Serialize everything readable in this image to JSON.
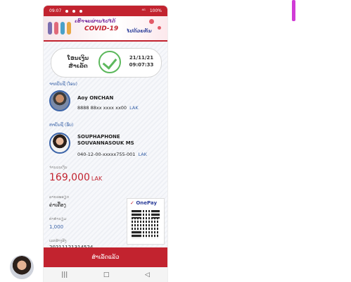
{
  "status_bar": {
    "time": "09:07",
    "net": "⁴ᴳ",
    "battery": "100%"
  },
  "banner": {
    "line1": "ເຮົາຈະຜ່ານໄປໄດ້",
    "line2": "COVID-19",
    "line3": "ໄປດ້ວຍກັນ"
  },
  "status": {
    "label": "ໂອນເງິນ ສຳເລັດ",
    "date": "21/11/21",
    "time": "09:07:33"
  },
  "sender": {
    "section_label": "ຈາກບັນຊີ (ໂອນ)",
    "name": "Aoy ONCHAN",
    "account": "8888 88xx xxxx xx00",
    "currency": "LAK"
  },
  "receiver": {
    "section_label": "ຫາບັນຊີ (ຮັບ)",
    "name_line1": "SOUPHAPHONE",
    "name_line2": "SOUVANNASOUK MS",
    "account": "040-12-00-xxxxx755-001",
    "currency": "LAK"
  },
  "amount": {
    "label": "ຈຳນວນເງິນ",
    "value": "169,000",
    "currency": "LAK"
  },
  "details": [
    {
      "label": "ລາຍລະອຽດ",
      "value": "ຄ່າເຄື່ອງ"
    },
    {
      "label": "ຄ່າທຳນຽມ",
      "value": "1,000"
    },
    {
      "label": "ເລກອ້າງອີງ",
      "value": "20211121314524"
    }
  ],
  "qr": {
    "logo_text": "OnePay"
  },
  "buttons": {
    "done": "ສຳເລັດແລ້ວ"
  },
  "navbar": {
    "menu": "|||",
    "home": "□",
    "back": "◁"
  }
}
